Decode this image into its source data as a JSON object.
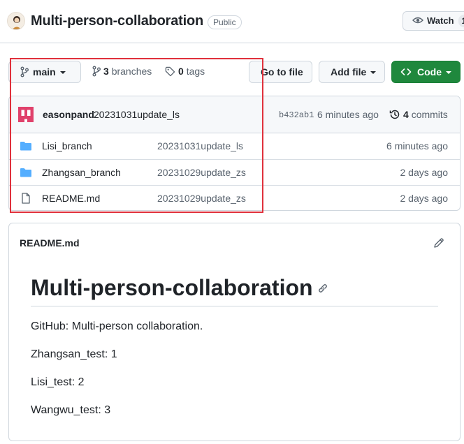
{
  "header": {
    "repo_name": "Multi-person-collaboration",
    "visibility": "Public",
    "watch_label": "Watch",
    "watch_count": "1"
  },
  "toolbar": {
    "branch": "main",
    "branches_count": "3",
    "branches_label": "branches",
    "tags_count": "0",
    "tags_label": "tags",
    "goto_file": "Go to file",
    "add_file": "Add file",
    "code": "Code"
  },
  "commit": {
    "author": "easonpand",
    "message": "20231031update_ls",
    "sha": "b432ab1",
    "time": "6 minutes ago",
    "count": "4",
    "count_label": "commits"
  },
  "files": [
    {
      "type": "folder",
      "name": "Lisi_branch",
      "commit": "20231031update_ls",
      "time": "6 minutes ago"
    },
    {
      "type": "folder",
      "name": "Zhangsan_branch",
      "commit": "20231029update_zs",
      "time": "2 days ago"
    },
    {
      "type": "file",
      "name": "README.md",
      "commit": "20231029update_zs",
      "time": "2 days ago"
    }
  ],
  "readme": {
    "filename": "README.md",
    "heading": "Multi-person-collaboration",
    "paragraphs": [
      "GitHub: Multi-person collaboration.",
      "Zhangsan_test: 1",
      "Lisi_test: 2",
      "Wangwu_test: 3"
    ]
  },
  "colors": {
    "primary_button": "#1f883d",
    "folder_icon": "#54aeff",
    "highlight_border": "#e0313c",
    "avatar_identicon": "#e0416b"
  }
}
